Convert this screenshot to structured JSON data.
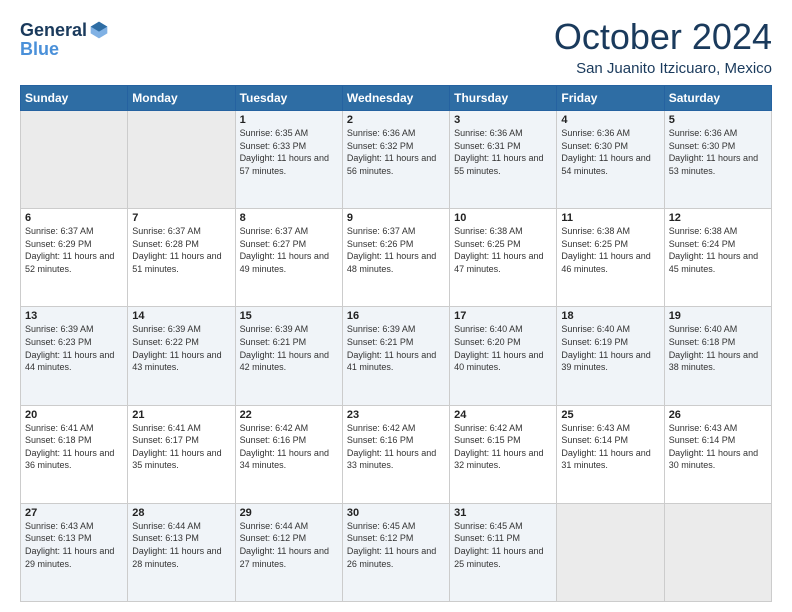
{
  "header": {
    "logo_line1": "General",
    "logo_line2": "Blue",
    "month": "October 2024",
    "location": "San Juanito Itzicuaro, Mexico"
  },
  "weekdays": [
    "Sunday",
    "Monday",
    "Tuesday",
    "Wednesday",
    "Thursday",
    "Friday",
    "Saturday"
  ],
  "weeks": [
    [
      {
        "day": "",
        "sunrise": "",
        "sunset": "",
        "daylight": ""
      },
      {
        "day": "",
        "sunrise": "",
        "sunset": "",
        "daylight": ""
      },
      {
        "day": "1",
        "sunrise": "Sunrise: 6:35 AM",
        "sunset": "Sunset: 6:33 PM",
        "daylight": "Daylight: 11 hours and 57 minutes."
      },
      {
        "day": "2",
        "sunrise": "Sunrise: 6:36 AM",
        "sunset": "Sunset: 6:32 PM",
        "daylight": "Daylight: 11 hours and 56 minutes."
      },
      {
        "day": "3",
        "sunrise": "Sunrise: 6:36 AM",
        "sunset": "Sunset: 6:31 PM",
        "daylight": "Daylight: 11 hours and 55 minutes."
      },
      {
        "day": "4",
        "sunrise": "Sunrise: 6:36 AM",
        "sunset": "Sunset: 6:30 PM",
        "daylight": "Daylight: 11 hours and 54 minutes."
      },
      {
        "day": "5",
        "sunrise": "Sunrise: 6:36 AM",
        "sunset": "Sunset: 6:30 PM",
        "daylight": "Daylight: 11 hours and 53 minutes."
      }
    ],
    [
      {
        "day": "6",
        "sunrise": "Sunrise: 6:37 AM",
        "sunset": "Sunset: 6:29 PM",
        "daylight": "Daylight: 11 hours and 52 minutes."
      },
      {
        "day": "7",
        "sunrise": "Sunrise: 6:37 AM",
        "sunset": "Sunset: 6:28 PM",
        "daylight": "Daylight: 11 hours and 51 minutes."
      },
      {
        "day": "8",
        "sunrise": "Sunrise: 6:37 AM",
        "sunset": "Sunset: 6:27 PM",
        "daylight": "Daylight: 11 hours and 49 minutes."
      },
      {
        "day": "9",
        "sunrise": "Sunrise: 6:37 AM",
        "sunset": "Sunset: 6:26 PM",
        "daylight": "Daylight: 11 hours and 48 minutes."
      },
      {
        "day": "10",
        "sunrise": "Sunrise: 6:38 AM",
        "sunset": "Sunset: 6:25 PM",
        "daylight": "Daylight: 11 hours and 47 minutes."
      },
      {
        "day": "11",
        "sunrise": "Sunrise: 6:38 AM",
        "sunset": "Sunset: 6:25 PM",
        "daylight": "Daylight: 11 hours and 46 minutes."
      },
      {
        "day": "12",
        "sunrise": "Sunrise: 6:38 AM",
        "sunset": "Sunset: 6:24 PM",
        "daylight": "Daylight: 11 hours and 45 minutes."
      }
    ],
    [
      {
        "day": "13",
        "sunrise": "Sunrise: 6:39 AM",
        "sunset": "Sunset: 6:23 PM",
        "daylight": "Daylight: 11 hours and 44 minutes."
      },
      {
        "day": "14",
        "sunrise": "Sunrise: 6:39 AM",
        "sunset": "Sunset: 6:22 PM",
        "daylight": "Daylight: 11 hours and 43 minutes."
      },
      {
        "day": "15",
        "sunrise": "Sunrise: 6:39 AM",
        "sunset": "Sunset: 6:21 PM",
        "daylight": "Daylight: 11 hours and 42 minutes."
      },
      {
        "day": "16",
        "sunrise": "Sunrise: 6:39 AM",
        "sunset": "Sunset: 6:21 PM",
        "daylight": "Daylight: 11 hours and 41 minutes."
      },
      {
        "day": "17",
        "sunrise": "Sunrise: 6:40 AM",
        "sunset": "Sunset: 6:20 PM",
        "daylight": "Daylight: 11 hours and 40 minutes."
      },
      {
        "day": "18",
        "sunrise": "Sunrise: 6:40 AM",
        "sunset": "Sunset: 6:19 PM",
        "daylight": "Daylight: 11 hours and 39 minutes."
      },
      {
        "day": "19",
        "sunrise": "Sunrise: 6:40 AM",
        "sunset": "Sunset: 6:18 PM",
        "daylight": "Daylight: 11 hours and 38 minutes."
      }
    ],
    [
      {
        "day": "20",
        "sunrise": "Sunrise: 6:41 AM",
        "sunset": "Sunset: 6:18 PM",
        "daylight": "Daylight: 11 hours and 36 minutes."
      },
      {
        "day": "21",
        "sunrise": "Sunrise: 6:41 AM",
        "sunset": "Sunset: 6:17 PM",
        "daylight": "Daylight: 11 hours and 35 minutes."
      },
      {
        "day": "22",
        "sunrise": "Sunrise: 6:42 AM",
        "sunset": "Sunset: 6:16 PM",
        "daylight": "Daylight: 11 hours and 34 minutes."
      },
      {
        "day": "23",
        "sunrise": "Sunrise: 6:42 AM",
        "sunset": "Sunset: 6:16 PM",
        "daylight": "Daylight: 11 hours and 33 minutes."
      },
      {
        "day": "24",
        "sunrise": "Sunrise: 6:42 AM",
        "sunset": "Sunset: 6:15 PM",
        "daylight": "Daylight: 11 hours and 32 minutes."
      },
      {
        "day": "25",
        "sunrise": "Sunrise: 6:43 AM",
        "sunset": "Sunset: 6:14 PM",
        "daylight": "Daylight: 11 hours and 31 minutes."
      },
      {
        "day": "26",
        "sunrise": "Sunrise: 6:43 AM",
        "sunset": "Sunset: 6:14 PM",
        "daylight": "Daylight: 11 hours and 30 minutes."
      }
    ],
    [
      {
        "day": "27",
        "sunrise": "Sunrise: 6:43 AM",
        "sunset": "Sunset: 6:13 PM",
        "daylight": "Daylight: 11 hours and 29 minutes."
      },
      {
        "day": "28",
        "sunrise": "Sunrise: 6:44 AM",
        "sunset": "Sunset: 6:13 PM",
        "daylight": "Daylight: 11 hours and 28 minutes."
      },
      {
        "day": "29",
        "sunrise": "Sunrise: 6:44 AM",
        "sunset": "Sunset: 6:12 PM",
        "daylight": "Daylight: 11 hours and 27 minutes."
      },
      {
        "day": "30",
        "sunrise": "Sunrise: 6:45 AM",
        "sunset": "Sunset: 6:12 PM",
        "daylight": "Daylight: 11 hours and 26 minutes."
      },
      {
        "day": "31",
        "sunrise": "Sunrise: 6:45 AM",
        "sunset": "Sunset: 6:11 PM",
        "daylight": "Daylight: 11 hours and 25 minutes."
      },
      {
        "day": "",
        "sunrise": "",
        "sunset": "",
        "daylight": ""
      },
      {
        "day": "",
        "sunrise": "",
        "sunset": "",
        "daylight": ""
      }
    ]
  ]
}
